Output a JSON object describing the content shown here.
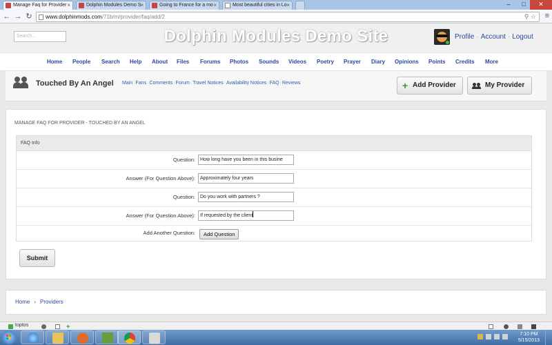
{
  "browser": {
    "tabs": [
      {
        "title": "Manage Faq for Provider",
        "active": true
      },
      {
        "title": "Dolphin Modules Demo S",
        "active": false
      },
      {
        "title": "Going to France for a mo",
        "active": false
      },
      {
        "title": "Most beautiful cities in Lo",
        "active": false
      }
    ],
    "url_host": "www.dolphinmods.com",
    "url_path": "/71b/m/provider/faq/add/2"
  },
  "header": {
    "search_placeholder": "Search...",
    "site_title": "Dolphin Modules Demo Site",
    "user_links": [
      "Profile",
      "Account",
      "Logout"
    ]
  },
  "menu": [
    "Home",
    "People",
    "Search",
    "Help",
    "About",
    "Files",
    "Forums",
    "Photos",
    "Sounds",
    "Videos",
    "Poetry",
    "Prayer",
    "Diary",
    "Opinions",
    "Points",
    "Credits",
    "More"
  ],
  "provider": {
    "name": "Touched By An Angel",
    "links": [
      "Main",
      "Fans",
      "Comments",
      "Forum",
      "Travel Notices",
      "Availability Notices",
      "FAQ",
      "Reviews"
    ],
    "add_button": "Add Provider",
    "my_button": "My Provider"
  },
  "content": {
    "title": "MANAGE FAQ FOR PROVIDER - TOUCHED BY AN ANGEL",
    "form_header": "FAQ Info",
    "rows": [
      {
        "label": "Question:",
        "value": "How long have you been in this busine"
      },
      {
        "label": "Answer (For Question Above):",
        "value": "Approximately four years"
      },
      {
        "label": "Question:",
        "value": "Do you work with partners ?"
      },
      {
        "label": "Answer (For Question Above):",
        "value": "If requested by the client"
      }
    ],
    "add_label": "Add Another Question:",
    "add_button": "Add Question",
    "submit": "Submit"
  },
  "breadcrumb": [
    "Home",
    "Providers"
  ],
  "dock": {
    "label": "toptos"
  },
  "taskbar": {
    "time": "7:10 PM",
    "date": "5/15/2013"
  },
  "colors": {
    "link": "#2a4a9a",
    "plus_green": "#2f9a2f",
    "taskbar": "#3f6ea6"
  }
}
